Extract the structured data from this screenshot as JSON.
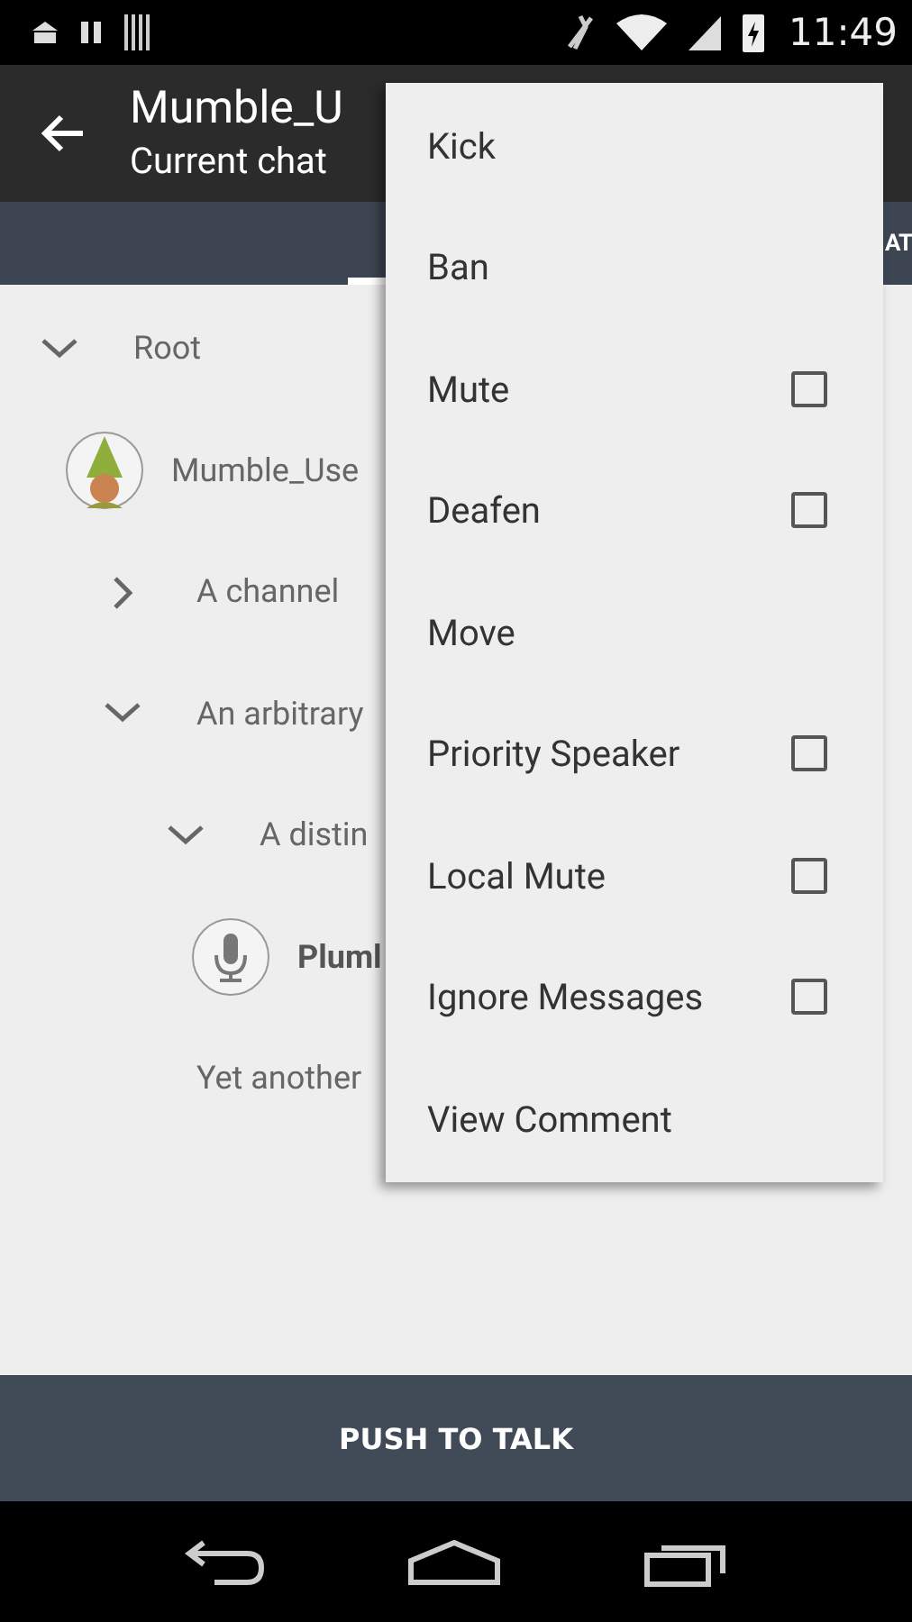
{
  "status_bar": {
    "time": "11:49"
  },
  "toolbar": {
    "title": "Mumble_U",
    "subtitle": "Current chat"
  },
  "tabs": [
    {
      "selected": true
    },
    {
      "label": "AT",
      "selected": false
    }
  ],
  "tree": [
    {
      "kind": "channel",
      "name": "Root",
      "expanded": true,
      "children": [
        {
          "kind": "user",
          "name": "Mumble_Use"
        },
        {
          "kind": "channel",
          "name": "A channel",
          "expanded": false
        },
        {
          "kind": "channel",
          "name": "An arbitrary",
          "expanded": true,
          "children": [
            {
              "kind": "channel",
              "name": "A distin",
              "expanded": true,
              "children": [
                {
                  "kind": "speaker",
                  "name": "Pluml",
                  "bold": true
                }
              ]
            }
          ]
        },
        {
          "kind": "channel",
          "name": "Yet another"
        }
      ]
    }
  ],
  "menu": [
    {
      "kind": "action",
      "label": "Kick"
    },
    {
      "kind": "action",
      "label": "Ban"
    },
    {
      "kind": "checkbox",
      "label": "Mute",
      "checked": false
    },
    {
      "kind": "checkbox",
      "label": "Deafen",
      "checked": false
    },
    {
      "kind": "action",
      "label": "Move"
    },
    {
      "kind": "checkbox",
      "label": "Priority Speaker",
      "checked": false
    },
    {
      "kind": "checkbox",
      "label": "Local Mute",
      "checked": false
    },
    {
      "kind": "checkbox",
      "label": "Ignore Messages",
      "checked": false
    },
    {
      "kind": "action",
      "label": "View Comment"
    }
  ],
  "push_to_talk": {
    "label": "PUSH TO TALK"
  }
}
